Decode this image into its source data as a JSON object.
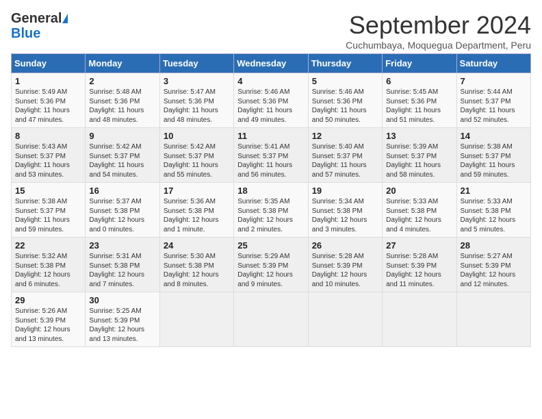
{
  "header": {
    "logo_general": "General",
    "logo_blue": "Blue",
    "month": "September 2024",
    "location": "Cuchumbaya, Moquegua Department, Peru"
  },
  "weekdays": [
    "Sunday",
    "Monday",
    "Tuesday",
    "Wednesday",
    "Thursday",
    "Friday",
    "Saturday"
  ],
  "weeks": [
    [
      {
        "day": "1",
        "lines": [
          "Sunrise: 5:49 AM",
          "Sunset: 5:36 PM",
          "Daylight: 11 hours",
          "and 47 minutes."
        ]
      },
      {
        "day": "2",
        "lines": [
          "Sunrise: 5:48 AM",
          "Sunset: 5:36 PM",
          "Daylight: 11 hours",
          "and 48 minutes."
        ]
      },
      {
        "day": "3",
        "lines": [
          "Sunrise: 5:47 AM",
          "Sunset: 5:36 PM",
          "Daylight: 11 hours",
          "and 48 minutes."
        ]
      },
      {
        "day": "4",
        "lines": [
          "Sunrise: 5:46 AM",
          "Sunset: 5:36 PM",
          "Daylight: 11 hours",
          "and 49 minutes."
        ]
      },
      {
        "day": "5",
        "lines": [
          "Sunrise: 5:46 AM",
          "Sunset: 5:36 PM",
          "Daylight: 11 hours",
          "and 50 minutes."
        ]
      },
      {
        "day": "6",
        "lines": [
          "Sunrise: 5:45 AM",
          "Sunset: 5:36 PM",
          "Daylight: 11 hours",
          "and 51 minutes."
        ]
      },
      {
        "day": "7",
        "lines": [
          "Sunrise: 5:44 AM",
          "Sunset: 5:37 PM",
          "Daylight: 11 hours",
          "and 52 minutes."
        ]
      }
    ],
    [
      {
        "day": "8",
        "lines": [
          "Sunrise: 5:43 AM",
          "Sunset: 5:37 PM",
          "Daylight: 11 hours",
          "and 53 minutes."
        ]
      },
      {
        "day": "9",
        "lines": [
          "Sunrise: 5:42 AM",
          "Sunset: 5:37 PM",
          "Daylight: 11 hours",
          "and 54 minutes."
        ]
      },
      {
        "day": "10",
        "lines": [
          "Sunrise: 5:42 AM",
          "Sunset: 5:37 PM",
          "Daylight: 11 hours",
          "and 55 minutes."
        ]
      },
      {
        "day": "11",
        "lines": [
          "Sunrise: 5:41 AM",
          "Sunset: 5:37 PM",
          "Daylight: 11 hours",
          "and 56 minutes."
        ]
      },
      {
        "day": "12",
        "lines": [
          "Sunrise: 5:40 AM",
          "Sunset: 5:37 PM",
          "Daylight: 11 hours",
          "and 57 minutes."
        ]
      },
      {
        "day": "13",
        "lines": [
          "Sunrise: 5:39 AM",
          "Sunset: 5:37 PM",
          "Daylight: 11 hours",
          "and 58 minutes."
        ]
      },
      {
        "day": "14",
        "lines": [
          "Sunrise: 5:38 AM",
          "Sunset: 5:37 PM",
          "Daylight: 11 hours",
          "and 59 minutes."
        ]
      }
    ],
    [
      {
        "day": "15",
        "lines": [
          "Sunrise: 5:38 AM",
          "Sunset: 5:37 PM",
          "Daylight: 11 hours",
          "and 59 minutes."
        ]
      },
      {
        "day": "16",
        "lines": [
          "Sunrise: 5:37 AM",
          "Sunset: 5:38 PM",
          "Daylight: 12 hours",
          "and 0 minutes."
        ]
      },
      {
        "day": "17",
        "lines": [
          "Sunrise: 5:36 AM",
          "Sunset: 5:38 PM",
          "Daylight: 12 hours",
          "and 1 minute."
        ]
      },
      {
        "day": "18",
        "lines": [
          "Sunrise: 5:35 AM",
          "Sunset: 5:38 PM",
          "Daylight: 12 hours",
          "and 2 minutes."
        ]
      },
      {
        "day": "19",
        "lines": [
          "Sunrise: 5:34 AM",
          "Sunset: 5:38 PM",
          "Daylight: 12 hours",
          "and 3 minutes."
        ]
      },
      {
        "day": "20",
        "lines": [
          "Sunrise: 5:33 AM",
          "Sunset: 5:38 PM",
          "Daylight: 12 hours",
          "and 4 minutes."
        ]
      },
      {
        "day": "21",
        "lines": [
          "Sunrise: 5:33 AM",
          "Sunset: 5:38 PM",
          "Daylight: 12 hours",
          "and 5 minutes."
        ]
      }
    ],
    [
      {
        "day": "22",
        "lines": [
          "Sunrise: 5:32 AM",
          "Sunset: 5:38 PM",
          "Daylight: 12 hours",
          "and 6 minutes."
        ]
      },
      {
        "day": "23",
        "lines": [
          "Sunrise: 5:31 AM",
          "Sunset: 5:38 PM",
          "Daylight: 12 hours",
          "and 7 minutes."
        ]
      },
      {
        "day": "24",
        "lines": [
          "Sunrise: 5:30 AM",
          "Sunset: 5:38 PM",
          "Daylight: 12 hours",
          "and 8 minutes."
        ]
      },
      {
        "day": "25",
        "lines": [
          "Sunrise: 5:29 AM",
          "Sunset: 5:39 PM",
          "Daylight: 12 hours",
          "and 9 minutes."
        ]
      },
      {
        "day": "26",
        "lines": [
          "Sunrise: 5:28 AM",
          "Sunset: 5:39 PM",
          "Daylight: 12 hours",
          "and 10 minutes."
        ]
      },
      {
        "day": "27",
        "lines": [
          "Sunrise: 5:28 AM",
          "Sunset: 5:39 PM",
          "Daylight: 12 hours",
          "and 11 minutes."
        ]
      },
      {
        "day": "28",
        "lines": [
          "Sunrise: 5:27 AM",
          "Sunset: 5:39 PM",
          "Daylight: 12 hours",
          "and 12 minutes."
        ]
      }
    ],
    [
      {
        "day": "29",
        "lines": [
          "Sunrise: 5:26 AM",
          "Sunset: 5:39 PM",
          "Daylight: 12 hours",
          "and 13 minutes."
        ]
      },
      {
        "day": "30",
        "lines": [
          "Sunrise: 5:25 AM",
          "Sunset: 5:39 PM",
          "Daylight: 12 hours",
          "and 13 minutes."
        ]
      },
      {
        "day": "",
        "lines": []
      },
      {
        "day": "",
        "lines": []
      },
      {
        "day": "",
        "lines": []
      },
      {
        "day": "",
        "lines": []
      },
      {
        "day": "",
        "lines": []
      }
    ]
  ]
}
